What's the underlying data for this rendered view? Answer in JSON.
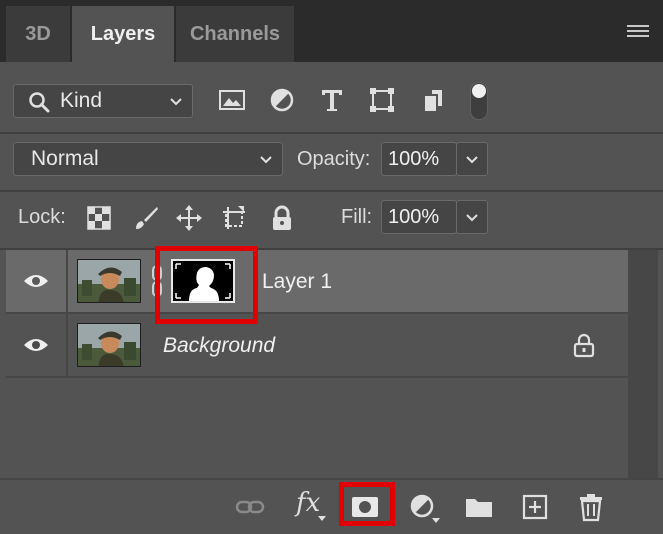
{
  "tabs": [
    {
      "label": "3D"
    },
    {
      "label": "Layers"
    },
    {
      "label": "Channels"
    }
  ],
  "filter": {
    "kind_label": "Kind"
  },
  "blend": {
    "mode": "Normal",
    "opacity_label": "Opacity:",
    "opacity_value": "100%"
  },
  "lock": {
    "label": "Lock:",
    "fill_label": "Fill:",
    "fill_value": "100%"
  },
  "layers": [
    {
      "name": "Layer 1",
      "visible": true,
      "selected": true,
      "has_mask": true
    },
    {
      "name": "Background",
      "visible": true,
      "selected": false,
      "locked": true
    }
  ],
  "bottom": {
    "fx_label": "fx"
  },
  "colors": {
    "highlight": "#e10000",
    "panel": "#535353",
    "selected_row": "#6a6a6a"
  }
}
